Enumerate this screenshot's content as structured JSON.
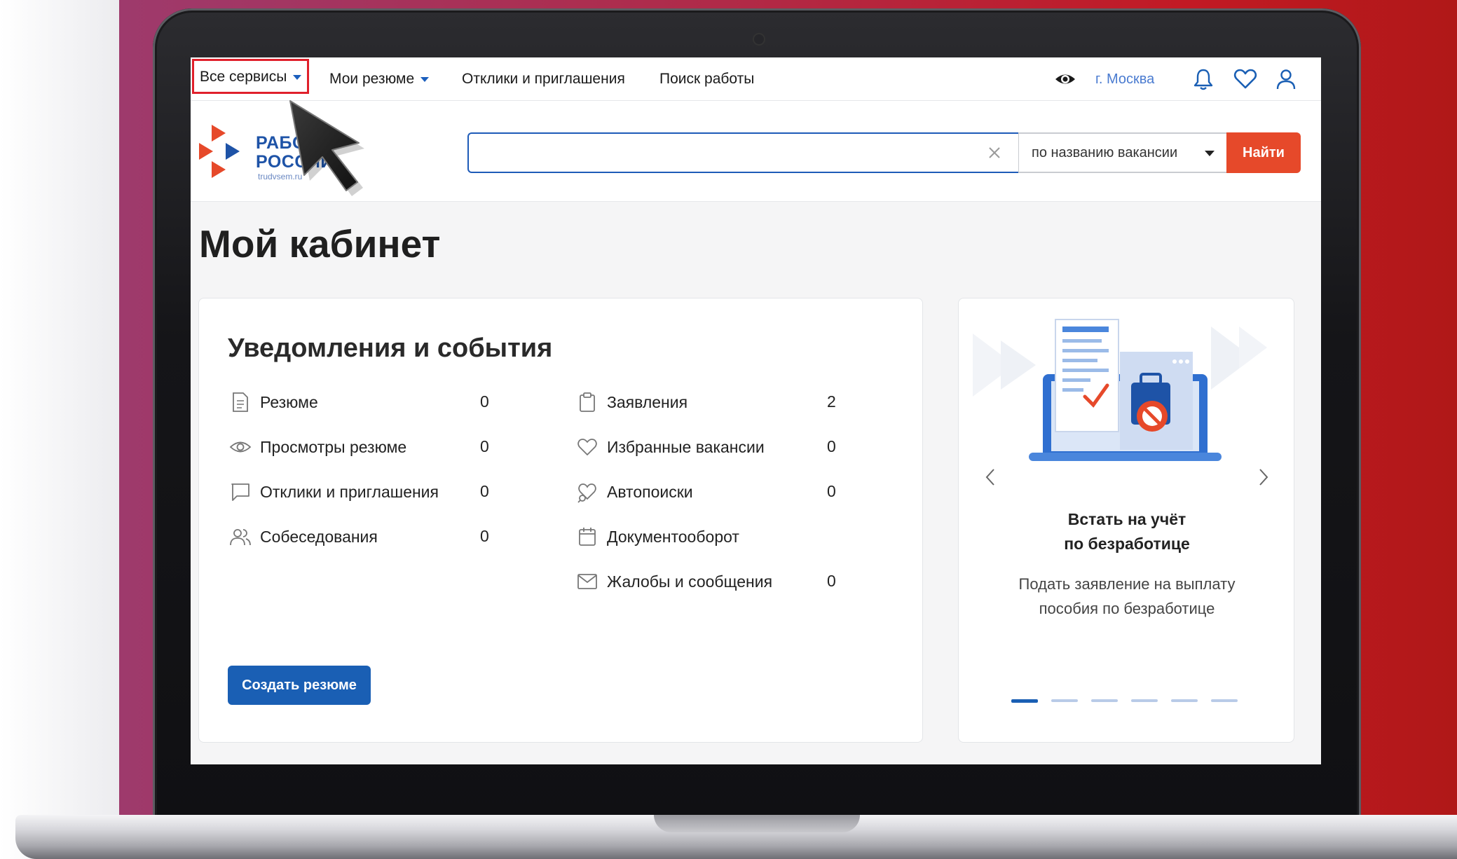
{
  "topnav": {
    "all_services": "Все сервисы",
    "my_resumes": "Мои резюме",
    "responses": "Отклики и приглашения",
    "job_search": "Поиск работы",
    "city": "г. Москва"
  },
  "logo": {
    "line1": "РАБОТА",
    "line2": "РОССИИ",
    "domain": "trudvsem.ru"
  },
  "search": {
    "value": "",
    "placeholder": "",
    "mode": "по названию вакансии",
    "button": "Найти"
  },
  "page": {
    "title": "Мой кабинет"
  },
  "events": {
    "title": "Уведомления и события",
    "left": [
      {
        "icon": "document-icon",
        "label": "Резюме",
        "count": "0"
      },
      {
        "icon": "eye-icon",
        "label": "Просмотры резюме",
        "count": "0"
      },
      {
        "icon": "chat-icon",
        "label": "Отклики и приглашения",
        "count": "0"
      },
      {
        "icon": "people-icon",
        "label": "Собеседования",
        "count": "0"
      }
    ],
    "right": [
      {
        "icon": "clipboard-icon",
        "label": "Заявления",
        "count": "2"
      },
      {
        "icon": "heart-icon",
        "label": "Избранные вакансии",
        "count": "0"
      },
      {
        "icon": "autosearch-icon",
        "label": "Автопоиски",
        "count": "0"
      },
      {
        "icon": "calendar-icon",
        "label": "Документооборот",
        "count": ""
      },
      {
        "icon": "mail-icon",
        "label": "Жалобы и сообщения",
        "count": "0"
      }
    ],
    "create_button": "Создать резюме"
  },
  "promo": {
    "title_line1": "Встать на учёт",
    "title_line2": "по безработице",
    "desc_line1": "Подать заявление на выплату",
    "desc_line2": "пособия по безработице",
    "slides": 6,
    "active_slide": 1
  },
  "colors": {
    "brand_blue": "#1a5fb4",
    "accent_orange": "#e6492a",
    "highlight_red": "#e0202b"
  }
}
